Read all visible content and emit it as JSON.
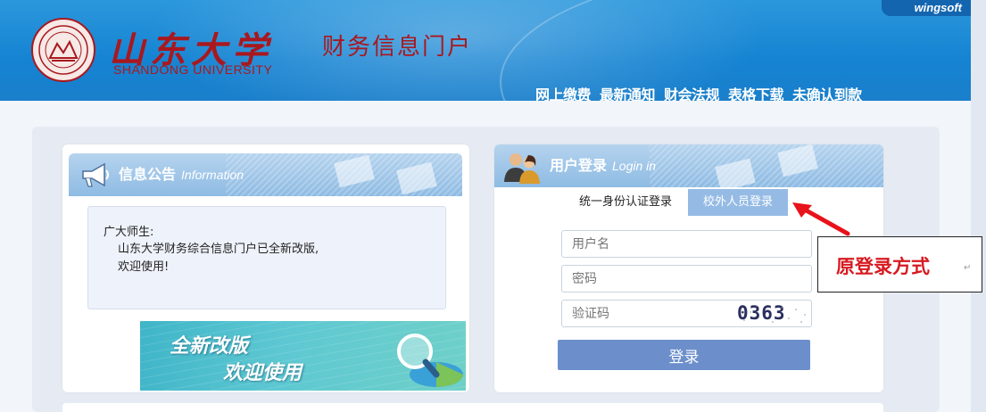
{
  "header": {
    "university_cn": "山东大学",
    "university_en": "SHANDONG UNIVERSITY",
    "portal_title": "财务信息门户",
    "brand": "wingsoft",
    "nav": [
      "网上缴费",
      "最新通知",
      "财会法规",
      "表格下载",
      "未确认到款"
    ]
  },
  "notice": {
    "title": "信息公告",
    "title_en": "Information",
    "greeting": "广大师生:",
    "lines": [
      "山东大学财务综合信息门户已全新改版,",
      "欢迎使用!"
    ],
    "banner_line1": "全新改版",
    "banner_line2": "欢迎使用"
  },
  "login": {
    "title": "用户登录",
    "title_en": "Login in",
    "tabs": [
      "统一身份认证登录",
      "校外人员登录"
    ],
    "active_tab": 1,
    "username_placeholder": "用户名",
    "password_placeholder": "密码",
    "captcha_placeholder": "验证码",
    "captcha_code": "0363",
    "submit": "登录"
  },
  "annotation": {
    "text": "原登录方式",
    "mark": "↵"
  },
  "colors": {
    "header_blue": "#1a85d3",
    "seal_red": "#a9181e",
    "active_tab": "#95bbe5",
    "login_button": "#6c8fcb",
    "annotation_red": "#d71920"
  }
}
